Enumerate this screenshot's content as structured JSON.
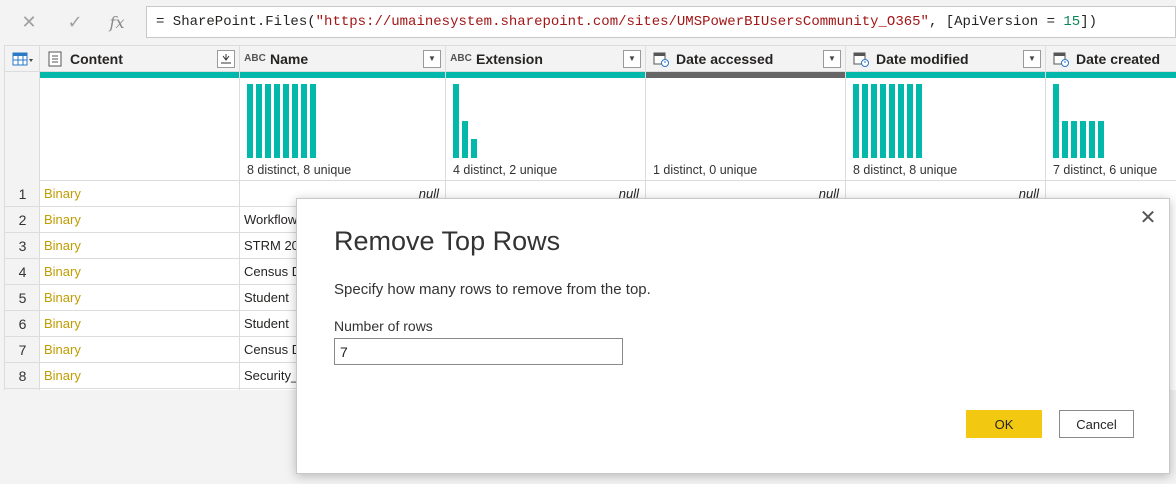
{
  "formula_bar": {
    "cancel_icon": "x-icon",
    "commit_icon": "check-icon",
    "fx_label": "fx",
    "formula_prefix": "= SharePoint.Files(",
    "formula_url": "\"https://umainesystem.sharepoint.com/sites/UMSPowerBIUsersCommunity_O365\"",
    "formula_mid": ", [ApiVersion = ",
    "formula_num": "15",
    "formula_suffix": "])"
  },
  "grid": {
    "columns": [
      {
        "name": "Content",
        "type_icon": "binary-icon",
        "quality_color": "#01b8aa",
        "profile_text": ""
      },
      {
        "name": "Name",
        "type_icon": "text-type-icon",
        "type_label": "ABC",
        "quality_color": "#01b8aa",
        "profile_text": "8 distinct, 8 unique"
      },
      {
        "name": "Extension",
        "type_icon": "text-type-icon",
        "type_label": "ABC",
        "quality_color": "#01b8aa",
        "profile_text": "4 distinct, 2 unique"
      },
      {
        "name": "Date accessed",
        "type_icon": "datetime-type-icon",
        "quality_color": "#666666",
        "profile_text": "1 distinct, 0 unique"
      },
      {
        "name": "Date modified",
        "type_icon": "datetime-type-icon",
        "quality_color": "#01b8aa",
        "profile_text": "8 distinct, 8 unique"
      },
      {
        "name": "Date created",
        "type_icon": "datetime-type-icon",
        "quality_color": "#01b8aa",
        "profile_text": "7 distinct, 6 unique"
      }
    ],
    "row_numbers": [
      "1",
      "2",
      "3",
      "4",
      "5",
      "6",
      "7",
      "8"
    ],
    "content_values": [
      "Binary",
      "Binary",
      "Binary",
      "Binary",
      "Binary",
      "Binary",
      "Binary",
      "Binary"
    ],
    "name_values": [
      "null",
      "Workflow",
      "STRM 20",
      "Census D",
      "Student",
      "Student",
      "Census D",
      "Security_"
    ],
    "null_text": "null",
    "name_bar_counts": [
      1,
      1,
      1,
      1,
      1,
      1,
      1,
      1
    ],
    "extension_bar_counts": [
      4,
      2,
      1
    ],
    "date_modified_bar_counts": [
      1,
      1,
      1,
      1,
      1,
      1,
      1,
      1
    ],
    "date_created_bar_counts": [
      2,
      1,
      1,
      1,
      1,
      1
    ]
  },
  "dialog": {
    "title": "Remove Top Rows",
    "description": "Specify how many rows to remove from the top.",
    "field_label": "Number of rows",
    "field_value": "7",
    "ok_label": "OK",
    "cancel_label": "Cancel",
    "close_icon": "close-icon",
    "ok_color": "#f2c811"
  }
}
